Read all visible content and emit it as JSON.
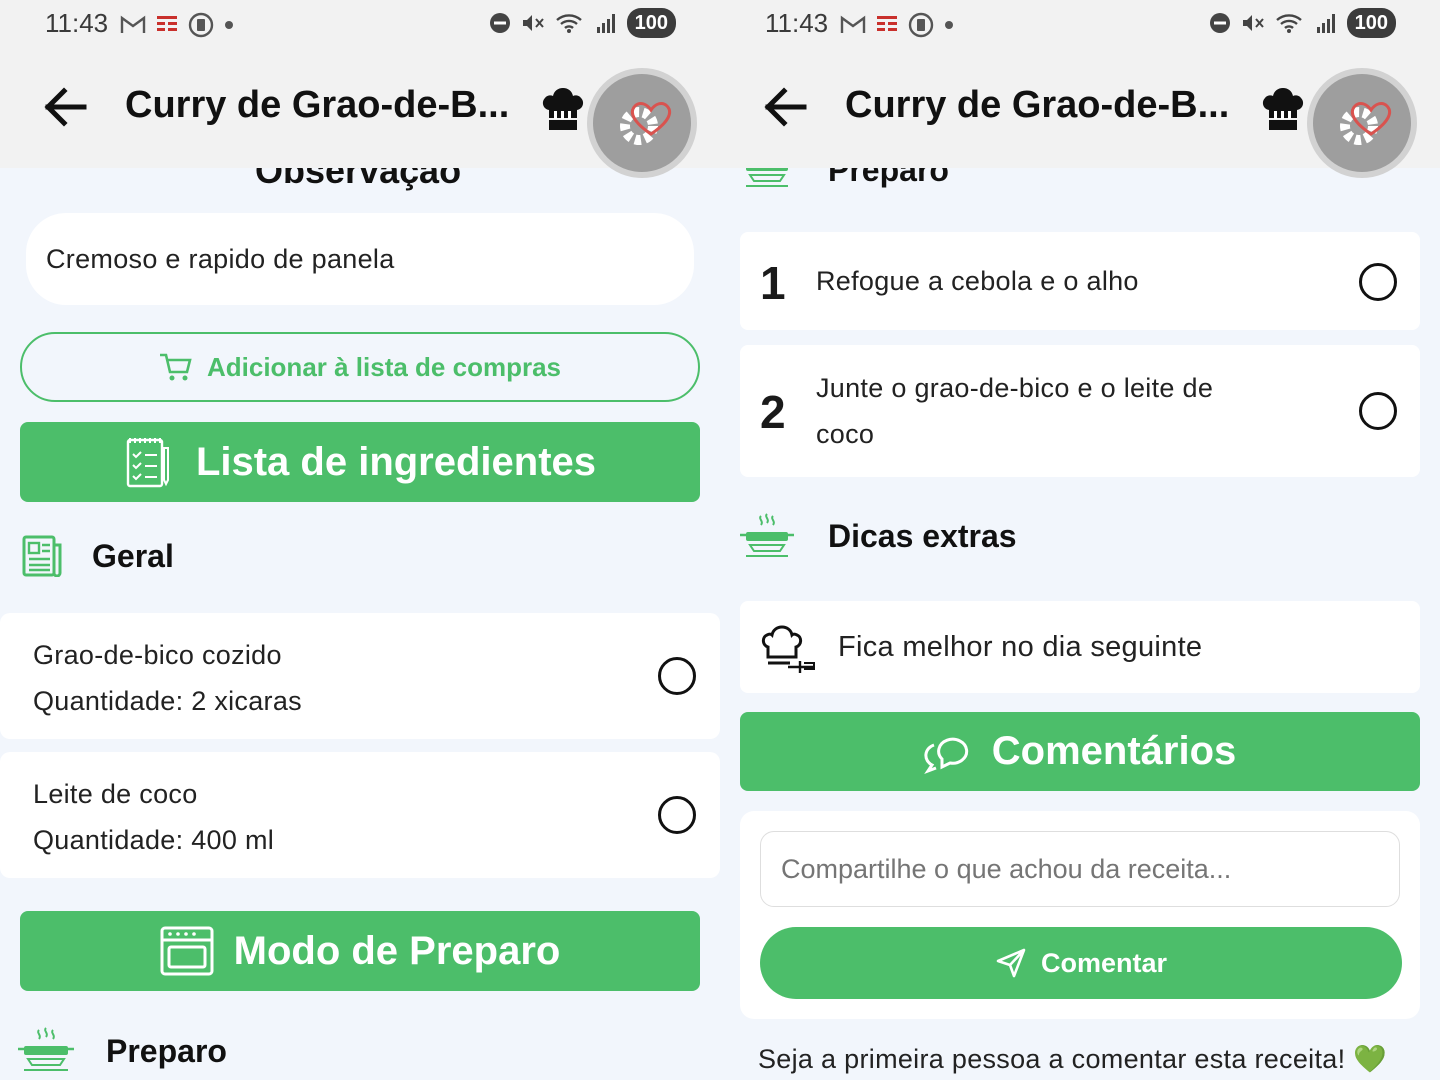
{
  "status_bar": {
    "time": "11:43",
    "battery": "100"
  },
  "app_bar": {
    "title": "Curry de Grao-de-B..."
  },
  "left": {
    "observation_heading": "Observação",
    "observation_text": "Cremoso e rapido de panela",
    "add_to_list_label": "Adicionar à lista de compras",
    "ingredients_bar_label": "Lista de ingredientes",
    "group_label": "Geral",
    "ingredients": [
      {
        "name": "Grao-de-bico cozido",
        "quantity": "Quantidade: 2 xicaras"
      },
      {
        "name": "Leite de coco",
        "quantity": "Quantidade: 400 ml"
      }
    ],
    "method_bar_label": "Modo de Preparo",
    "prep_heading": "Preparo"
  },
  "right": {
    "prep_heading": "Preparo",
    "steps": [
      {
        "number": "1",
        "text_line1": "Refogue a cebola e o alho",
        "text_line2": ""
      },
      {
        "number": "2",
        "text_line1": "Junte o grao-de-bico e o leite de",
        "text_line2": "coco"
      }
    ],
    "tips_heading": "Dicas extras",
    "tip_text": "Fica melhor no dia seguinte",
    "comments_bar_label": "Comentários",
    "comment_placeholder": "Compartilhe o que achou da receita...",
    "comment_button_label": "Comentar",
    "empty_comments_text": "Seja a primeira pessoa a comentar esta receita! 💚"
  },
  "colors": {
    "accent_green": "#4cbe6a",
    "background": "#f2f6fc",
    "appbar": "#f2f2f2"
  },
  "icons": [
    "back-arrow-icon",
    "chef-hat-icon",
    "favorite-gear-heart-icon",
    "shopping-cart-icon",
    "checklist-icon",
    "newspaper-icon",
    "oven-icon",
    "steaming-pan-icon",
    "chef-hat-utensils-icon",
    "chat-bubbles-icon",
    "send-icon",
    "green-heart-icon"
  ]
}
